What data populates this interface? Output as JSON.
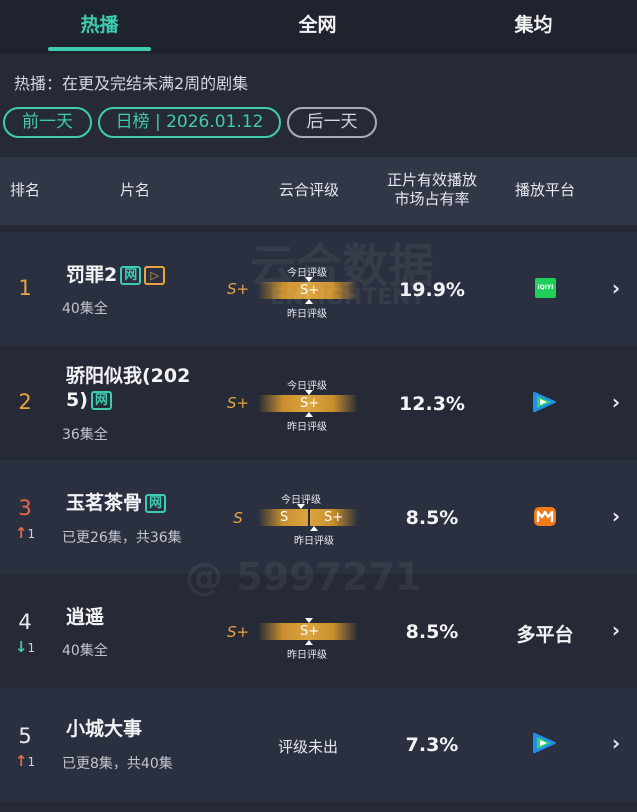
{
  "tabs": [
    {
      "label": "热播",
      "active": true
    },
    {
      "label": "全网",
      "active": false
    },
    {
      "label": "集均",
      "active": false
    }
  ],
  "description": "热播：在更及完结未满2周的剧集",
  "controls": {
    "prev": "前一天",
    "date": "日榜 | 2026.01.12",
    "next": "后一天"
  },
  "header": {
    "rank": "排名",
    "name": "片名",
    "rating": "云合评级",
    "share_line1": "正片有效播放",
    "share_line2": "市场占有率",
    "platform": "播放平台"
  },
  "rows": [
    {
      "rank": "1",
      "title": "罚罪2",
      "badge_net": "网",
      "badge_play": "▷",
      "episodes": "40集全",
      "grade": "S+",
      "today_label": "今日评级",
      "bar_today": "S+",
      "yesterday_label": "昨日评级",
      "share": "19.9%",
      "platform": "iQIYI",
      "platform_icon": "iqiyi-icon"
    },
    {
      "rank": "2",
      "title_line1": "骄阳似我(202",
      "title_line2": "5)",
      "badge_net": "网",
      "episodes": "36集全",
      "grade": "S+",
      "today_label": "今日评级",
      "bar_today": "S+",
      "yesterday_label": "昨日评级",
      "share": "12.3%",
      "platform_icon": "tencent-video-icon"
    },
    {
      "rank": "3",
      "change": "1",
      "change_dir": "up",
      "title": "玉茗茶骨",
      "badge_net": "网",
      "episodes": "已更26集，共36集",
      "grade": "S",
      "today_label": "今日评级",
      "bar_today": "S",
      "bar_yesterday": "S+",
      "yesterday_label": "昨日评级",
      "share": "8.5%",
      "platform_icon": "mango-tv-icon"
    },
    {
      "rank": "4",
      "change": "1",
      "change_dir": "down",
      "title": "逍遥",
      "episodes": "40集全",
      "grade": "S+",
      "bar_today": "S+",
      "yesterday_label": "昨日评级",
      "share": "8.5%",
      "platform": "多平台"
    },
    {
      "rank": "5",
      "change": "1",
      "change_dir": "up",
      "title": "小城大事",
      "episodes": "已更8集，共40集",
      "rating_text": "评级未出",
      "share": "7.3%",
      "platform_icon": "tencent-video-icon"
    }
  ],
  "watermark": {
    "line1": "云合数据",
    "line2": "ENLIGHTENT",
    "line3": "@ 5997271"
  },
  "colors": {
    "accent": "#3ecbb0",
    "gold": "#e8a440",
    "rank_up": "#e46a4e",
    "background": "#262a36"
  }
}
